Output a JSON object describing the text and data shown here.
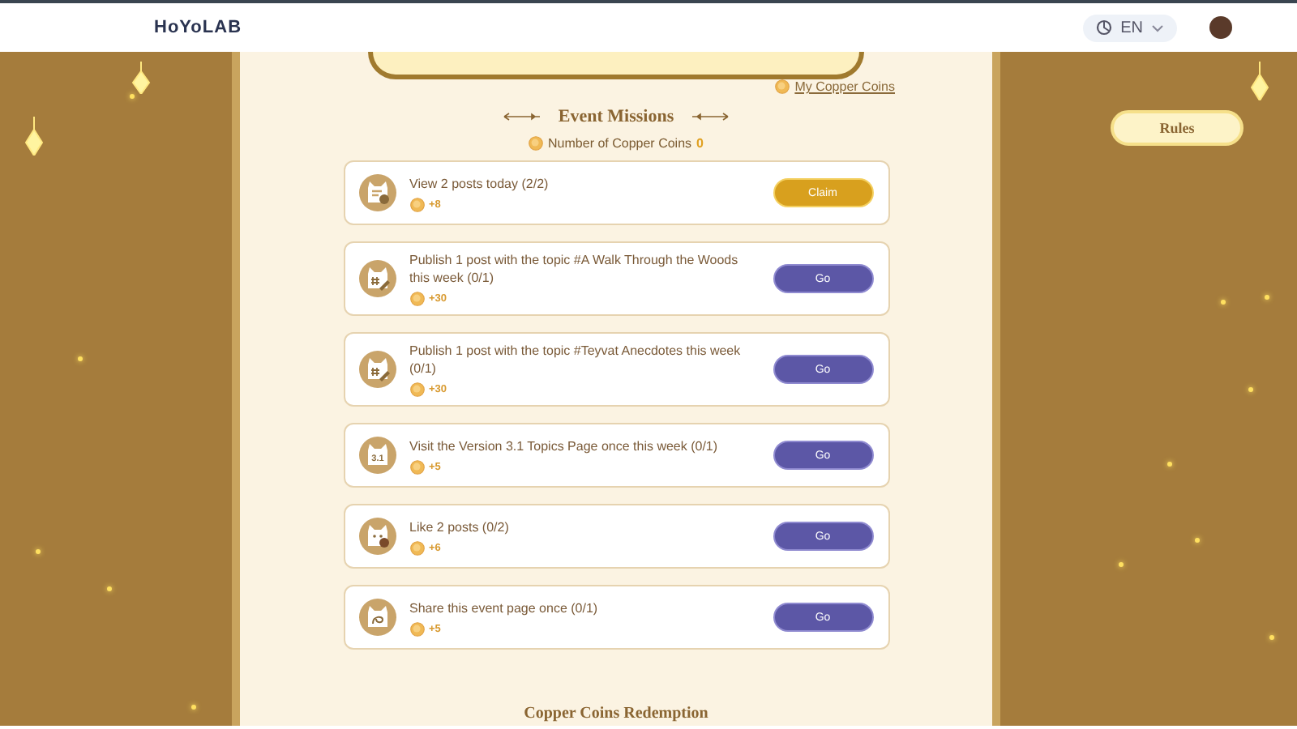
{
  "header": {
    "logo": "HoYoLAB",
    "language": "EN"
  },
  "rules_button": "Rules",
  "my_coins_link": "My Copper Coins",
  "section_title": "Event Missions",
  "coins": {
    "label": "Number of Copper Coins",
    "value": "0"
  },
  "missions": [
    {
      "kind": "view",
      "title": "View 2 posts today (2/2)",
      "reward": "+8",
      "claimable": true,
      "action": "Claim"
    },
    {
      "kind": "topic",
      "title": "Publish 1 post with the topic #A Walk Through the Woods this week (0/1)",
      "reward": "+30",
      "claimable": false,
      "action": "Go"
    },
    {
      "kind": "topic",
      "title": "Publish 1 post with the topic #Teyvat Anecdotes this week (0/1)",
      "reward": "+30",
      "claimable": false,
      "action": "Go"
    },
    {
      "kind": "version",
      "icon_text": "3.1",
      "title": "Visit the Version 3.1 Topics Page once this week (0/1)",
      "reward": "+5",
      "claimable": false,
      "action": "Go"
    },
    {
      "kind": "like",
      "title": "Like 2 posts (0/2)",
      "reward": "+6",
      "claimable": false,
      "action": "Go"
    },
    {
      "kind": "share",
      "title": "Share this event page once (0/1)",
      "reward": "+5",
      "claimable": false,
      "action": "Go"
    }
  ],
  "next_section_title": "Copper Coins Redemption"
}
